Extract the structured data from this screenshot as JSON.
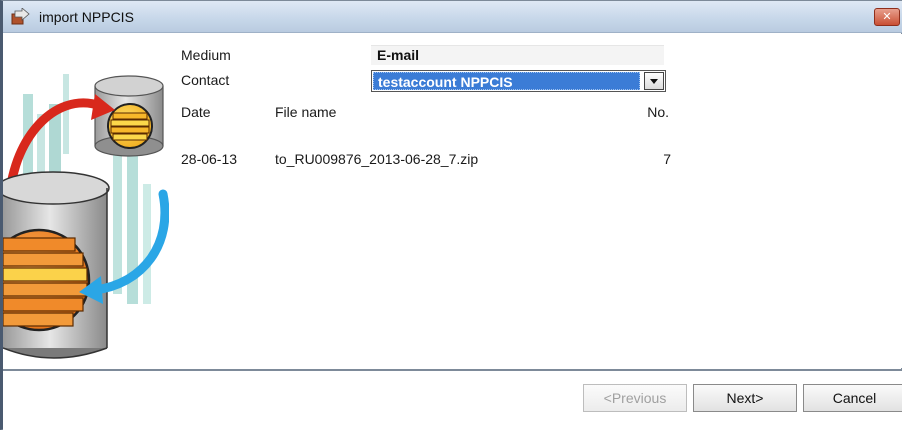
{
  "window": {
    "title": "import NPPCIS",
    "close_glyph": "✕"
  },
  "form": {
    "medium_label": "Medium",
    "medium_value": "E-mail",
    "contact_label": "Contact",
    "contact_value": "testaccount NPPCIS"
  },
  "table": {
    "headers": {
      "date": "Date",
      "file_name": "File name",
      "no": "No."
    },
    "rows": [
      {
        "date": "28-06-13",
        "file_name": "to_RU009876_2013-06-28_7.zip",
        "no": "7"
      }
    ]
  },
  "buttons": {
    "previous": "<Previous",
    "next": "Next>",
    "cancel": "Cancel"
  },
  "icons": {
    "title_icon": "import-app-icon",
    "close_icon": "close-icon",
    "dropdown_icon": "chevron-down-icon",
    "illustration": "database-sync-illustration"
  },
  "colors": {
    "selection": "#3b7cd6",
    "titlebar": "#c8d8ea",
    "close_button": "#c94f34"
  }
}
